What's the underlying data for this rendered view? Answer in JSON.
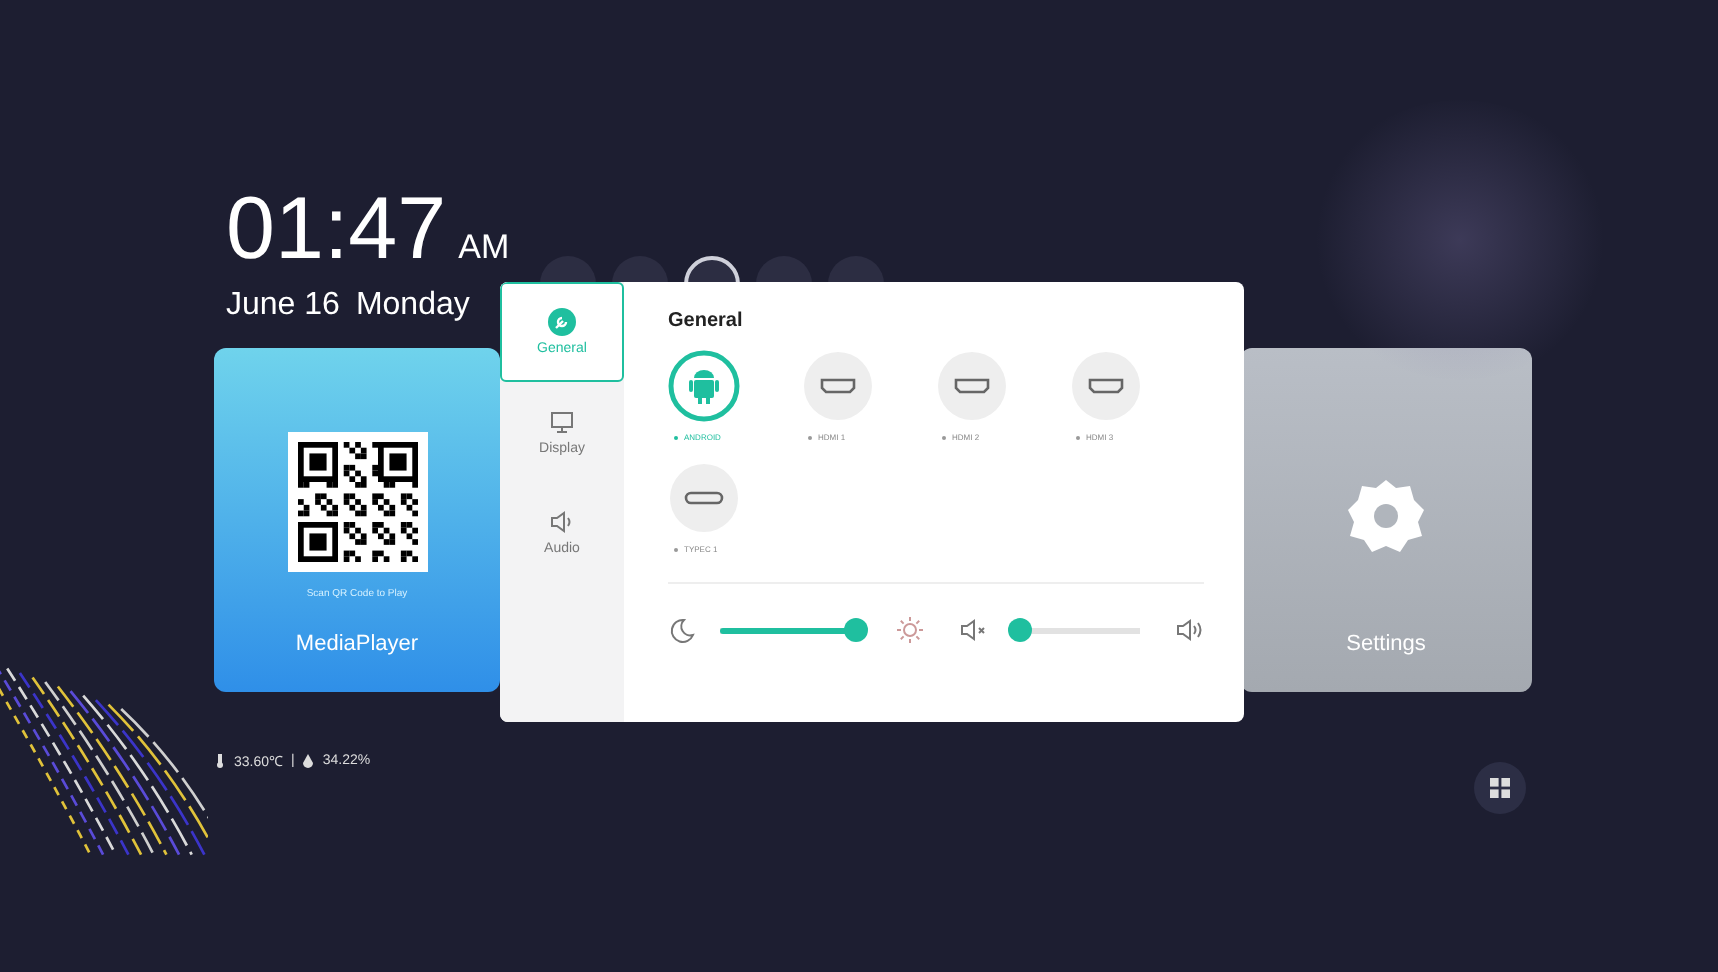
{
  "clock": {
    "time": "01:47",
    "meridiem": "AM",
    "date": "June 16",
    "weekday": "Monday"
  },
  "cards": [
    {
      "kind": "media",
      "label": "MediaPlayer",
      "caption": "Scan QR Code to Play"
    },
    {
      "kind": "settings",
      "label": "Settings"
    }
  ],
  "status": {
    "temperature": "33.60℃",
    "separator": "|",
    "humidity": "34.22%"
  },
  "popup": {
    "tabs": [
      {
        "label": "General",
        "kind": "general",
        "selected": true
      },
      {
        "label": "Display",
        "kind": "display",
        "selected": false
      },
      {
        "label": "Audio",
        "kind": "audio",
        "selected": false
      }
    ],
    "title": "General",
    "sources": [
      {
        "label": "ANDROID",
        "kind": "android",
        "selected": true
      },
      {
        "label": "HDMI 1",
        "kind": "hdmi",
        "selected": false
      },
      {
        "label": "HDMI 2",
        "kind": "hdmi",
        "selected": false
      },
      {
        "label": "HDMI 3",
        "kind": "hdmi",
        "selected": false
      },
      {
        "label": "TYPEC 1",
        "kind": "typec",
        "selected": false
      }
    ],
    "brightness": {
      "level": 0.97
    },
    "volume": {
      "level": 0.06
    }
  }
}
